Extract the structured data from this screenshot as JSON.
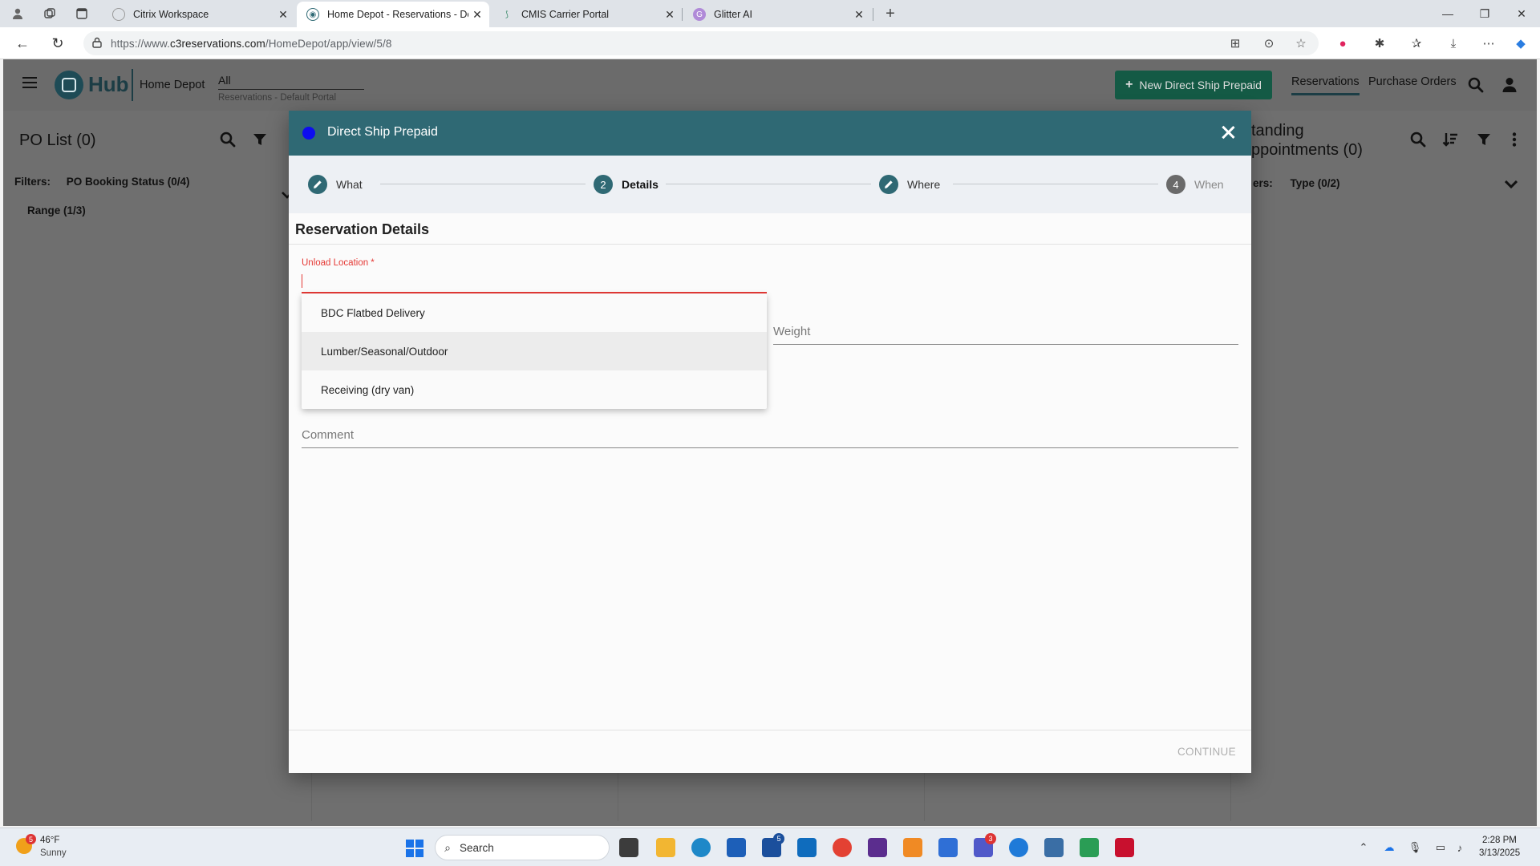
{
  "browser": {
    "tabs": [
      {
        "title": "Citrix Workspace",
        "active": false
      },
      {
        "title": "Home Depot - Reservations - Def",
        "active": true
      },
      {
        "title": "CMIS Carrier Portal",
        "active": false
      },
      {
        "title": "Glitter AI",
        "active": false
      }
    ],
    "url_prefix": "https://www.",
    "url_host": "c3reservations.com",
    "url_path": "/HomeDepot/app/view/5/8"
  },
  "app": {
    "logo_text": "Hub",
    "org_name": "Home Depot",
    "portal_value": "All",
    "portal_subtitle": "Reservations - Default Portal",
    "new_button_label": "New Direct Ship Prepaid",
    "nav": [
      {
        "label": "Reservations",
        "active": true
      },
      {
        "label": "Purchase Orders",
        "active": false
      }
    ],
    "left_panel": {
      "title": "PO List (0)",
      "filters_label": "Filters:",
      "filter_1": "PO Booking Status (0/4)",
      "filter_2": "Range (1/3)"
    },
    "right_panel": {
      "title_line1": "tanding",
      "title_line2": "ppointments (0)",
      "filters_label": "ers:",
      "filter_1": "Type (0/2)"
    }
  },
  "modal": {
    "title": "Direct Ship Prepaid",
    "accent_color": "#2f6974",
    "steps": [
      {
        "marker": "pencil",
        "label": "What",
        "state": "done"
      },
      {
        "marker": "2",
        "label": "Details",
        "state": "active"
      },
      {
        "marker": "pencil",
        "label": "Where",
        "state": "done"
      },
      {
        "marker": "4",
        "label": "When",
        "state": "todo"
      }
    ],
    "section_title": "Reservation Details",
    "unload_location": {
      "label": "Unload Location *",
      "value": "",
      "options": [
        "BDC Flatbed Delivery",
        "Lumber/Seasonal/Outdoor",
        "Receiving (dry van)"
      ],
      "highlighted_option": "Lumber/Seasonal/Outdoor"
    },
    "weight_placeholder": "Weight",
    "comment_placeholder": "Comment",
    "continue_label": "CONTINUE"
  },
  "taskbar": {
    "weather_temp": "46°F",
    "weather_desc": "Sunny",
    "weather_badge": "5",
    "search_placeholder": "Search",
    "badges": {
      "todo": "5",
      "teams": "3"
    },
    "time": "2:28 PM",
    "date": "3/13/2025"
  }
}
